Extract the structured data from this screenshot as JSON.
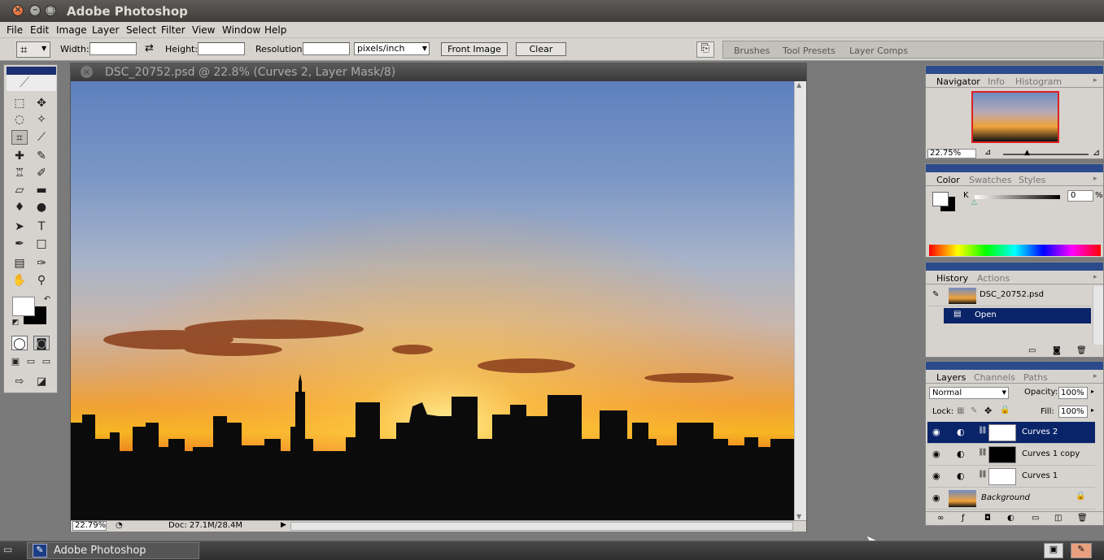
{
  "app": {
    "title": "Adobe Photoshop"
  },
  "menu": [
    "File",
    "Edit",
    "Image",
    "Layer",
    "Select",
    "Filter",
    "View",
    "Window",
    "Help"
  ],
  "options": {
    "width_label": "Width:",
    "height_label": "Height:",
    "resolution_label": "Resolution:",
    "resolution_unit": "pixels/inch",
    "front_image": "Front Image",
    "clear": "Clear"
  },
  "palette_well": [
    "Brushes",
    "Tool Presets",
    "Layer Comps"
  ],
  "document": {
    "title": "DSC_20752.psd @ 22.8% (Curves 2, Layer Mask/8)",
    "zoom": "22.79%",
    "doc_size": "Doc: 27.1M/28.4M"
  },
  "navigator": {
    "tabs": [
      "Navigator",
      "Info",
      "Histogram"
    ],
    "zoom": "22.75%"
  },
  "color": {
    "tabs": [
      "Color",
      "Swatches",
      "Styles"
    ],
    "channel": "K",
    "value": "0",
    "unit": "%"
  },
  "history": {
    "tabs": [
      "History",
      "Actions"
    ],
    "snapshot": "DSC_20752.psd",
    "items": [
      "Open"
    ]
  },
  "layers": {
    "tabs": [
      "Layers",
      "Channels",
      "Paths"
    ],
    "blend_mode": "Normal",
    "opacity_label": "Opacity:",
    "opacity": "100%",
    "lock_label": "Lock:",
    "fill_label": "Fill:",
    "fill": "100%",
    "items": [
      "Curves 2",
      "Curves 1 copy",
      "Curves 1",
      "Background"
    ]
  },
  "taskbar": {
    "app": "Adobe Photoshop"
  },
  "colors": {
    "selection": "#0a246a",
    "panel_header": "#2c4b8c"
  }
}
